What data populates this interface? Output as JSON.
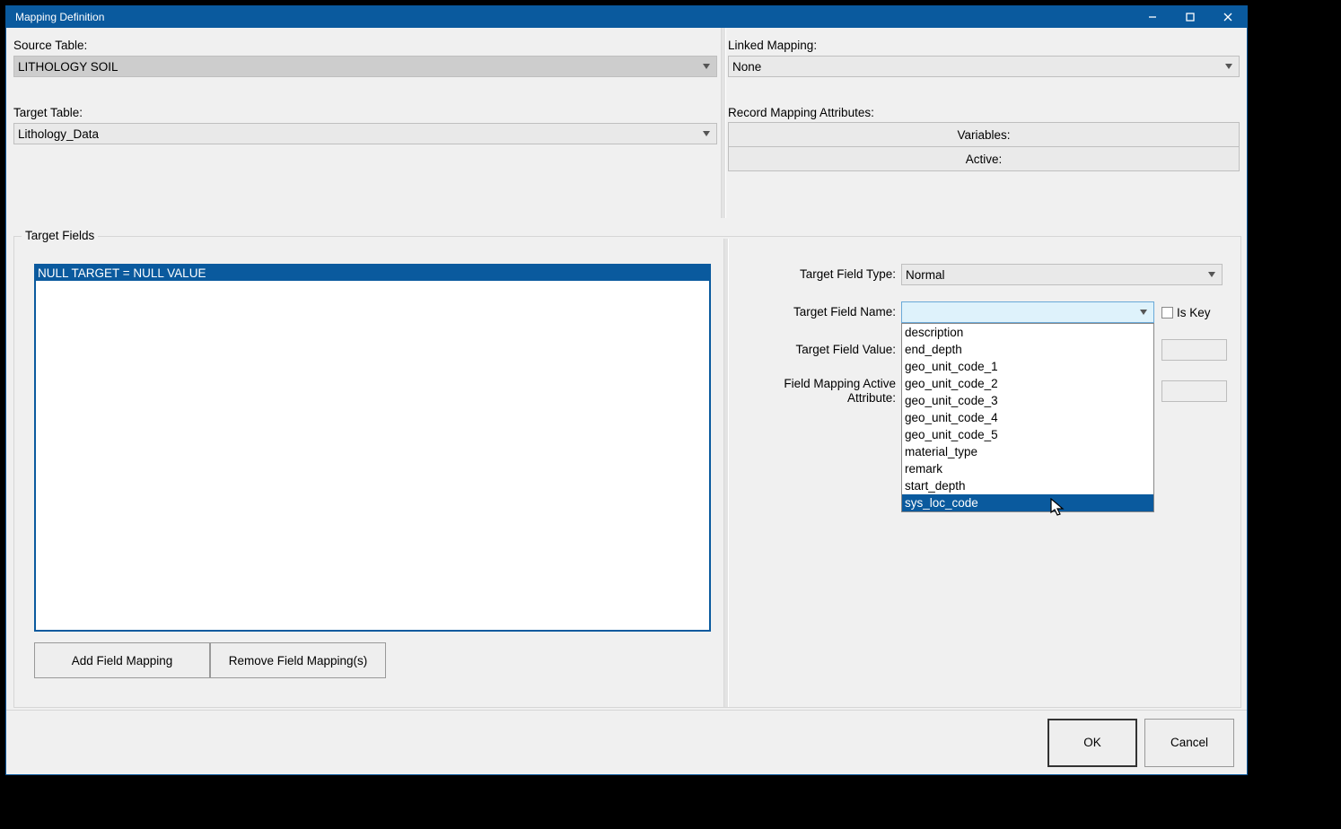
{
  "titlebar": {
    "title": "Mapping Definition"
  },
  "top": {
    "source_table_label": "Source Table:",
    "source_table_value": "LITHOLOGY SOIL",
    "target_table_label": "Target Table:",
    "target_table_value": "Lithology_Data",
    "linked_mapping_label": "Linked Mapping:",
    "linked_mapping_value": "None",
    "record_attrs_label": "Record Mapping Attributes:",
    "record_attrs_variables": "Variables:",
    "record_attrs_active": "Active:"
  },
  "target_fields": {
    "group_label": "Target Fields",
    "list": [
      "NULL TARGET = NULL VALUE"
    ],
    "selected_index": 0,
    "add_button": "Add Field Mapping",
    "remove_button": "Remove Field Mapping(s)",
    "form": {
      "type_label": "Target Field Type:",
      "type_value": "Normal",
      "name_label": "Target Field Name:",
      "name_value": "",
      "is_key_label": "Is Key",
      "value_label": "Target Field Value:",
      "attr_label": "Field Mapping Active Attribute:",
      "dropdown_options": [
        "description",
        "end_depth",
        "geo_unit_code_1",
        "geo_unit_code_2",
        "geo_unit_code_3",
        "geo_unit_code_4",
        "geo_unit_code_5",
        "material_type",
        "remark",
        "start_depth",
        "sys_loc_code"
      ],
      "dropdown_hover_index": 10
    }
  },
  "footer": {
    "ok": "OK",
    "cancel": "Cancel"
  }
}
